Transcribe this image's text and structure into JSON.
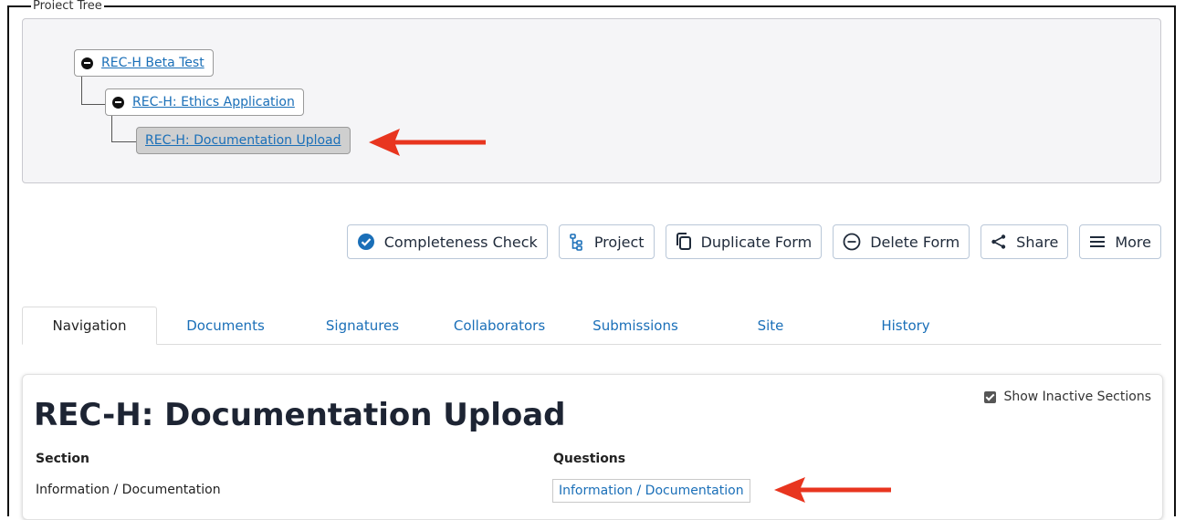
{
  "tree": {
    "legend": "Project Tree",
    "nodes": [
      {
        "label": "REC-H Beta Test"
      },
      {
        "label": "REC-H: Ethics Application"
      },
      {
        "label": "REC-H: Documentation Upload"
      }
    ]
  },
  "toolbar": {
    "completeness": "Completeness Check",
    "project": "Project",
    "duplicate": "Duplicate Form",
    "delete": "Delete Form",
    "share": "Share",
    "more": "More"
  },
  "tabs": {
    "navigation": "Navigation",
    "documents": "Documents",
    "signatures": "Signatures",
    "collaborators": "Collaborators",
    "submissions": "Submissions",
    "site": "Site",
    "history": "History"
  },
  "form": {
    "title": "REC-H: Documentation Upload",
    "show_inactive": "Show Inactive Sections",
    "section_header": "Section",
    "questions_header": "Questions",
    "section_value": "Information / Documentation",
    "question_link": "Information / Documentation"
  },
  "colors": {
    "link": "#1a6fb8",
    "annotation_arrow": "#e8351f",
    "check_icon": "#1a6fb8"
  }
}
